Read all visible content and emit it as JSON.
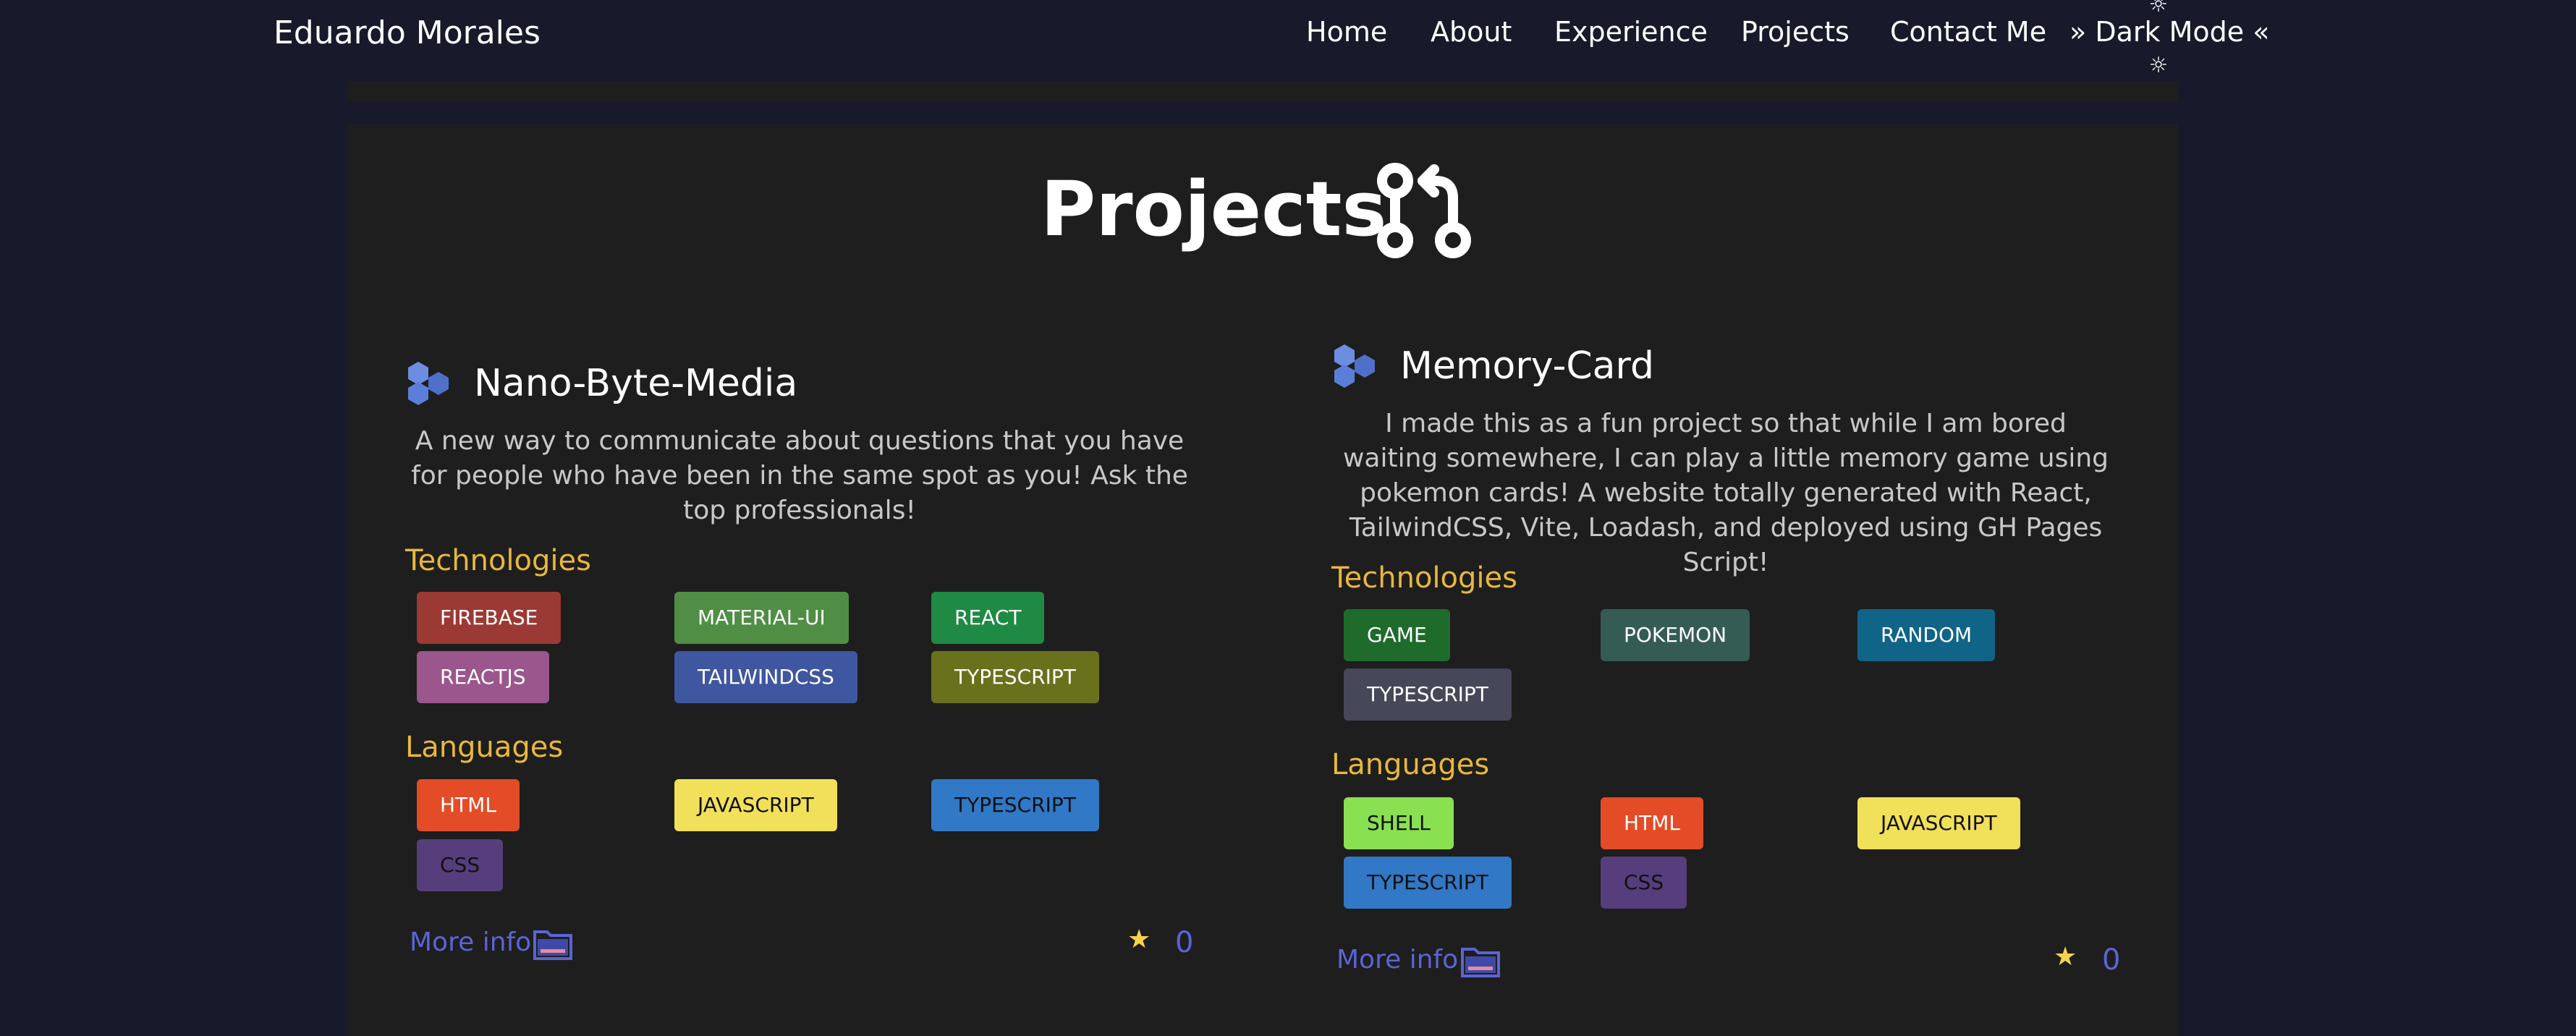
{
  "nav": {
    "brand": "Eduardo Morales",
    "links": [
      "Home",
      "About",
      "Experience",
      "Projects",
      "Contact Me"
    ],
    "theme_toggle": "» Dark Mode «"
  },
  "section": {
    "title": "Projects",
    "icon": "git-pull-request-icon"
  },
  "projects": [
    {
      "title": "Nano-Byte-Media",
      "description": "A new way to communicate about questions that you have for people who have been in the same spot as you! Ask the top professionals!",
      "technologies_label": "Technologies",
      "technologies": [
        {
          "name": "FIREBASE",
          "color": "#9b3a34"
        },
        {
          "name": "MATERIAL-UI",
          "color": "#4f8e44"
        },
        {
          "name": "REACT",
          "color": "#1f8a44"
        },
        {
          "name": "REACTJS",
          "color": "#9a568d"
        },
        {
          "name": "TAILWINDCSS",
          "color": "#3f56a0"
        },
        {
          "name": "TYPESCRIPT",
          "color": "#6a711c"
        }
      ],
      "languages_label": "Languages",
      "languages": [
        {
          "name": "HTML",
          "color": "#e34c26"
        },
        {
          "name": "JAVASCRIPT",
          "color": "#f1e05a"
        },
        {
          "name": "TYPESCRIPT",
          "color": "#3178c6"
        },
        {
          "name": "CSS",
          "color": "#563d7c"
        }
      ],
      "more_info": "More info",
      "stars": "0"
    },
    {
      "title": "Memory-Card",
      "description": "I made this as a fun project so that while I am bored waiting somewhere, I can play a little memory game using pokemon cards! A website totally generated with React, TailwindCSS, Vite, Loadash, and deployed using GH Pages Script!",
      "technologies_label": "Technologies",
      "technologies": [
        {
          "name": "GAME",
          "color": "#1e6b2c"
        },
        {
          "name": "POKEMON",
          "color": "#355b55"
        },
        {
          "name": "RANDOM",
          "color": "#0f6487"
        },
        {
          "name": "TYPESCRIPT",
          "color": "#47475a"
        }
      ],
      "languages_label": "Languages",
      "languages": [
        {
          "name": "SHELL",
          "color": "#89e051"
        },
        {
          "name": "HTML",
          "color": "#e34c26"
        },
        {
          "name": "JAVASCRIPT",
          "color": "#f1e05a"
        },
        {
          "name": "TYPESCRIPT",
          "color": "#3178c6"
        },
        {
          "name": "CSS",
          "color": "#563d7c"
        }
      ],
      "more_info": "More info",
      "stars": "0"
    }
  ],
  "colors": {
    "background": "#181a2b",
    "card": "#1e1e1e",
    "accent": "#5a64d6",
    "heading": "#e8b73d"
  }
}
